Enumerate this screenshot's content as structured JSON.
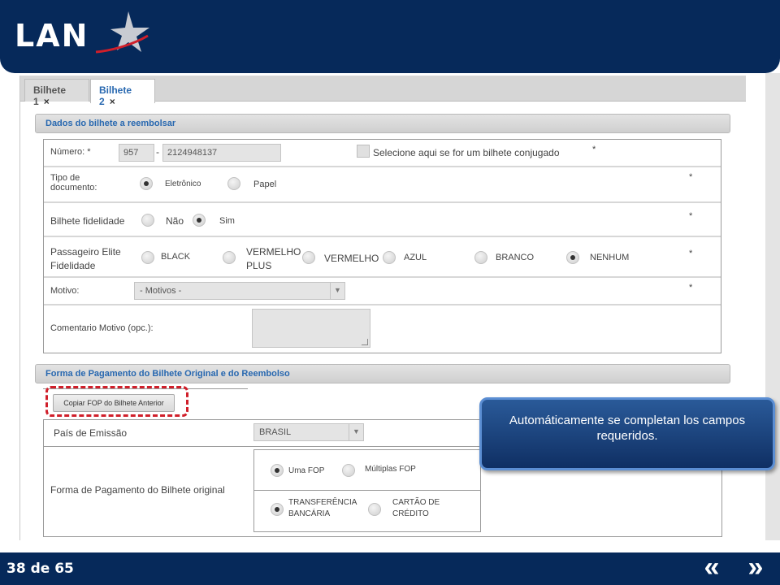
{
  "brand": {
    "name": "LAN",
    "primary_color": "#06295a",
    "accent_color": "#2868b0",
    "highlight_color": "#d01f2a"
  },
  "tabs": [
    {
      "label": "Bilhete 1",
      "close": "×"
    },
    {
      "label": "Bilhete 2",
      "close": "×"
    }
  ],
  "section1": {
    "title": "Dados do bilhete a reembolsar",
    "numero": {
      "label": "Número: *",
      "prefix": "957",
      "separator": "-",
      "number": "2124948137",
      "conjugado_label": "Selecione aqui se for um bilhete conjugado",
      "required": "*"
    },
    "tipo_documento": {
      "label": "Tipo de documento:",
      "options": [
        "Eletrônico",
        "Papel"
      ],
      "required": "*"
    },
    "fidelidade": {
      "label": "Bilhete fidelidade",
      "options": [
        "Não",
        "Sim"
      ],
      "required": "*"
    },
    "elite": {
      "label": "Passageiro Elite Fidelidade",
      "options": [
        "BLACK",
        "VERMELHO PLUS",
        "VERMELHO",
        "AZUL",
        "BRANCO",
        "NENHUM"
      ],
      "required": "*"
    },
    "motivo": {
      "label": "Motivo:",
      "value": "- Motivos -",
      "arrow": "▼",
      "required": "*"
    },
    "comentario": {
      "label": "Comentario Motivo (opc.):"
    }
  },
  "section2": {
    "title": "Forma de Pagamento do Bilhete Original e do Reembolso",
    "copy_button": "Copiar FOP do Bilhete Anterior",
    "pais": {
      "label": "País de Emissão",
      "value": "BRASIL",
      "arrow": "▼"
    },
    "fop": {
      "label": "Forma de Pagamento do Bilhete original",
      "row1": [
        "Uma FOP",
        "Múltiplas FOP"
      ],
      "row2": [
        "TRANSFERÊNCIA BANCÁRIA",
        "CARTÃO DE CRÉDITO"
      ]
    }
  },
  "tooltip": "Automáticamente se completan los campos requeridos.",
  "footer": {
    "page": "38 de 65",
    "prev": "«",
    "next": "»"
  }
}
